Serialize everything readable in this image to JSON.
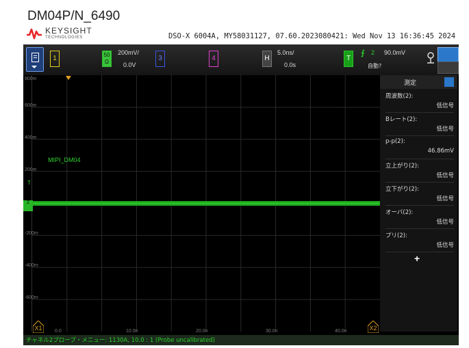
{
  "doc_title": "DM04P/N_6490",
  "brand": {
    "name": "KEYSIGHT",
    "sub": "TECHNOLOGIES",
    "accent": "#e8272b"
  },
  "header_info": "DSO-X 6004A, MY58031127, 07.60.2023080421: Wed Nov 13 16:36:45 2024",
  "topbar": {
    "ch1": "1",
    "ch2": "50\nΩ",
    "ch2_scale": "200mV/",
    "ch2_offset": "0.0V",
    "ch3": "3",
    "ch4": "4",
    "h_label": "H",
    "h_scale": "5.0ns/",
    "h_delay": "0.0s",
    "trig_label": "T",
    "trig_slope": "⨍",
    "trig_source": "2",
    "trig_level": "90.0mV",
    "trig_mode": "自動?"
  },
  "waveform": {
    "channel_label": "MIPI_DM04",
    "ground_marker": "2",
    "trig_level_marker": "T",
    "y_labels": [
      "800m",
      "600m",
      "400m",
      "200m",
      "-200m",
      "-400m",
      "-600m"
    ],
    "x_labels": [
      "0.0",
      "10.0n",
      "20.0n",
      "30.0n",
      "40.0n"
    ],
    "marker_x1": "X1",
    "marker_x2": "X2",
    "trace_color": "#2ee02e",
    "trace_level_v": 0.0
  },
  "measurements": {
    "title": "測定",
    "items": [
      {
        "name": "周波数(2):",
        "value": "低信号"
      },
      {
        "name": "Bレート(2):",
        "value": "低信号"
      },
      {
        "name": "p-p(2):",
        "value": "46.86mV"
      },
      {
        "name": "立上がり(2):",
        "value": "低信号"
      },
      {
        "name": "立下がり(2):",
        "value": "低信号"
      },
      {
        "name": "オーバ(2):",
        "value": "低信号"
      },
      {
        "name": "プリ(2):",
        "value": "低信号"
      }
    ],
    "add_label": "+"
  },
  "status": "チャネル2プローブ・メニュー: 1130A, 10.0 : 1 (Probe uncalibrated)"
}
